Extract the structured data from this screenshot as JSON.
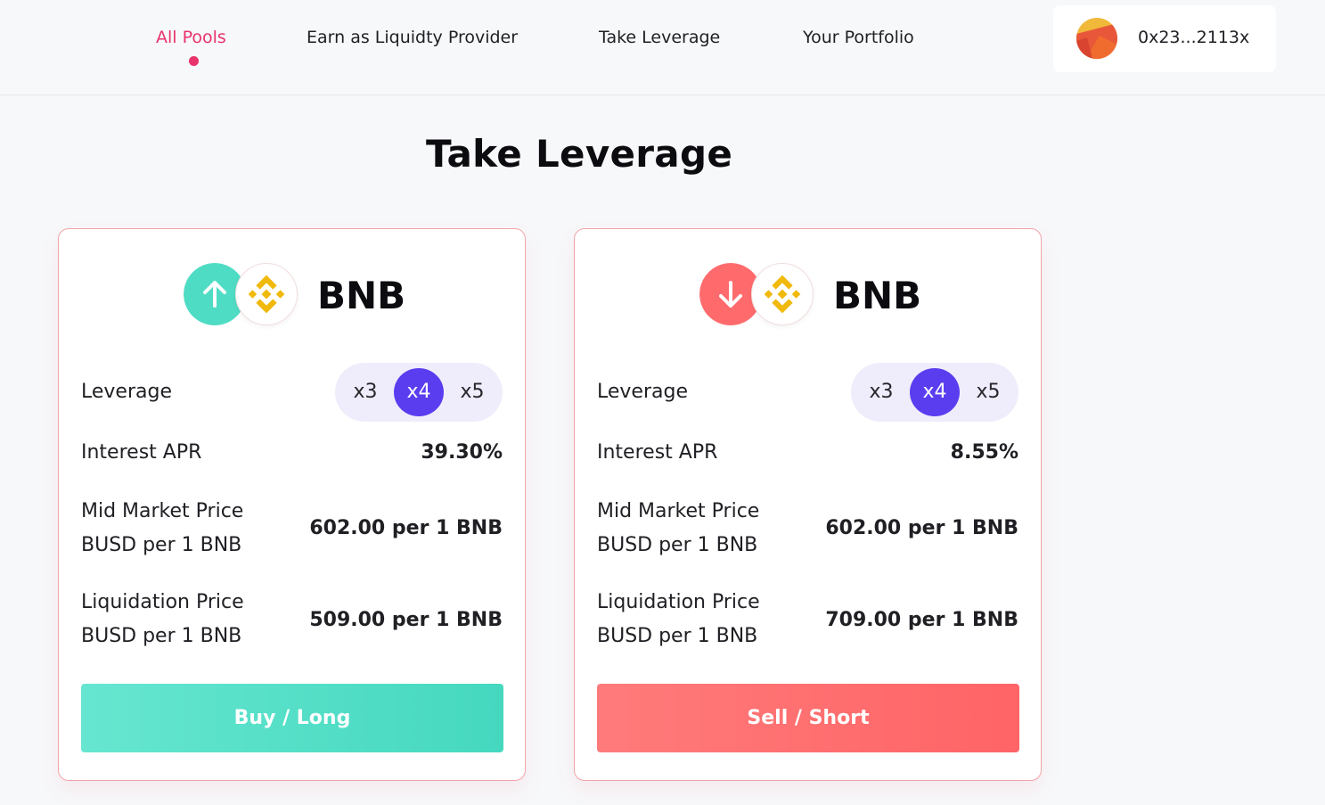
{
  "nav": {
    "items": [
      "All Pools",
      "Earn as Liquidty Provider",
      "Take Leverage",
      "Your Portfolio"
    ],
    "active": "All Pools"
  },
  "wallet": {
    "address": "0x23...2113x"
  },
  "page": {
    "title": "Take Leverage"
  },
  "cards": [
    {
      "direction": "up",
      "direction_icon": "arrow-up-icon",
      "coin_icon": "bnb-icon",
      "asset": "BNB",
      "leverage_label": "Leverage",
      "leverage_options": [
        "x3",
        "x4",
        "x5"
      ],
      "leverage_selected": "x4",
      "apr_label": "Interest APR",
      "apr_value": "39.30%",
      "mid_label_1": "Mid Market Price",
      "mid_label_2": "BUSD per 1 BNB",
      "mid_value": "602.00 per 1 BNB",
      "liq_label_1": "Liquidation Price",
      "liq_label_2": "BUSD per 1 BNB",
      "liq_value": "509.00 per 1 BNB",
      "action_label": "Buy / Long",
      "accent": "#4fdcc4"
    },
    {
      "direction": "down",
      "direction_icon": "arrow-down-icon",
      "coin_icon": "bnb-icon",
      "asset": "BNB",
      "leverage_label": "Leverage",
      "leverage_options": [
        "x3",
        "x4",
        "x5"
      ],
      "leverage_selected": "x4",
      "apr_label": "Interest APR",
      "apr_value": "8.55%",
      "mid_label_1": "Mid Market Price",
      "mid_label_2": "BUSD per 1 BNB",
      "mid_value": "602.00 per 1 BNB",
      "liq_label_1": "Liquidation Price",
      "liq_label_2": "BUSD per 1 BNB",
      "liq_value": "709.00 per 1 BNB",
      "action_label": "Sell / Short",
      "accent": "#ff6b6d"
    }
  ],
  "colors": {
    "nav_active": "#e8336b",
    "leverage_selected": "#5b3df0",
    "bnb": "#f0b90b",
    "card_border": "#f3a3a9"
  }
}
